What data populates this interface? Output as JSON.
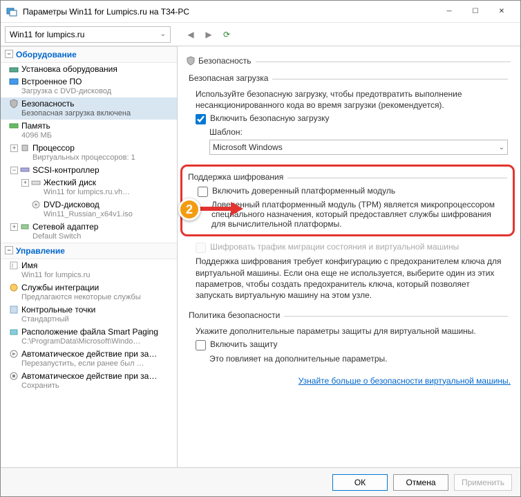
{
  "window": {
    "title": "Параметры Win11 for Lumpics.ru на T34-PC"
  },
  "toolbar": {
    "vm_name": "Win11 for lumpics.ru"
  },
  "sidebar": {
    "hardware_header": "Оборудование",
    "management_header": "Управление",
    "items": {
      "add_hw": {
        "label": "Установка оборудования"
      },
      "firmware": {
        "label": "Встроенное ПО",
        "sub": "Загрузка с DVD-дисковод"
      },
      "security": {
        "label": "Безопасность",
        "sub": "Безопасная загрузка включена"
      },
      "memory": {
        "label": "Память",
        "sub": "4096 МБ"
      },
      "cpu": {
        "label": "Процессор",
        "sub": "Виртуальных процессоров: 1"
      },
      "scsi": {
        "label": "SCSI-контроллер"
      },
      "hdd": {
        "label": "Жесткий диск",
        "sub": "Win11 for lumpics.ru.vh…"
      },
      "dvd": {
        "label": "DVD-дисковод",
        "sub": "Win11_Russian_x64v1.iso"
      },
      "nic": {
        "label": "Сетевой адаптер",
        "sub": "Default Switch"
      },
      "name": {
        "label": "Имя",
        "sub": "Win11 for lumpics.ru"
      },
      "integ": {
        "label": "Службы интеграции",
        "sub": "Предлагаются некоторые службы"
      },
      "ckpt": {
        "label": "Контрольные точки",
        "sub": "Стандартный"
      },
      "smart": {
        "label": "Расположение файла Smart Paging",
        "sub": "C:\\ProgramData\\Microsoft\\Windo…"
      },
      "auto_start": {
        "label": "Автоматическое действие при за…",
        "sub": "Перезапустить, если ранее был …"
      },
      "auto_stop": {
        "label": "Автоматическое действие при за…",
        "sub": "Сохранить"
      }
    }
  },
  "content": {
    "title": "Безопасность",
    "secure_boot": {
      "heading": "Безопасная загрузка",
      "desc": "Используйте безопасную загрузку, чтобы предотвратить выполнение несанкционированного кода во время загрузки (рекомендуется).",
      "enable_label": "Включить безопасную загрузку",
      "template_label": "Шаблон:",
      "template_value": "Microsoft Windows"
    },
    "encryption": {
      "heading": "Поддержка шифрования",
      "tpm_label": "Включить доверенный платформенный модуль",
      "tpm_desc": "Доверенный платформенный модуль (TPM) является микропроцессором специального назначения, который предоставляет службы шифрования для вычислительной платформы.",
      "migrate_label": "Шифровать трафик миграции состояния и виртуальной машины",
      "note": "Поддержка шифрования требует конфигурацию с предохранителем ключа для виртуальной машины. Если она еще не используется, выберите один из этих параметров, чтобы создать предохранитель ключа, который позволяет запускать виртуальную машину на этом узле."
    },
    "policy": {
      "heading": "Политика безопасности",
      "desc": "Укажите дополнительные параметры защиты для виртуальной машины.",
      "enable_label": "Включить защиту",
      "note": "Это повлияет на дополнительные параметры."
    },
    "link": "Узнайте больше о безопасности виртуальной машины."
  },
  "footer": {
    "ok": "ОК",
    "cancel": "Отмена",
    "apply": "Применить"
  },
  "badge": "2"
}
